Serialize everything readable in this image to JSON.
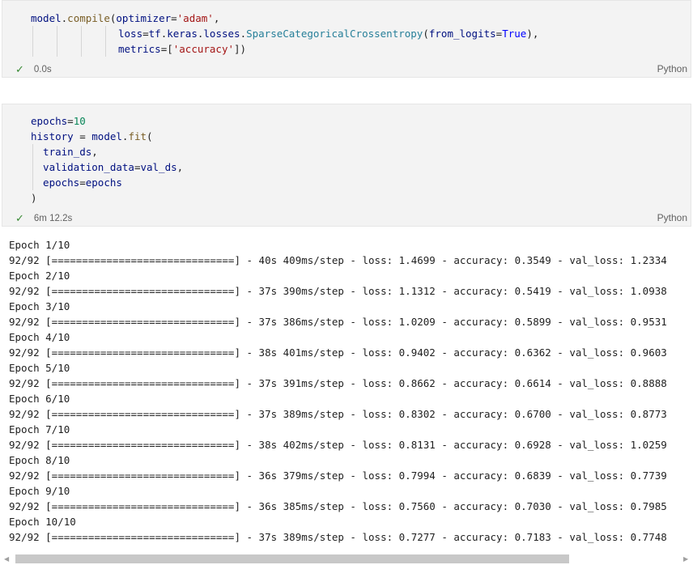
{
  "cells": [
    {
      "exec_time": "0.0s",
      "language": "Python",
      "code_lines": [
        [
          [
            "model",
            "k"
          ],
          [
            ".",
            "p"
          ],
          [
            "compile",
            "f"
          ],
          [
            "(",
            "p"
          ],
          [
            "optimizer",
            "k"
          ],
          [
            "=",
            "p"
          ],
          [
            "'adam'",
            "s"
          ],
          [
            ",",
            "p"
          ]
        ],
        [
          [
            "loss",
            "k"
          ],
          [
            "=",
            "p"
          ],
          [
            "tf",
            "k"
          ],
          [
            ".",
            "p"
          ],
          [
            "keras",
            "k"
          ],
          [
            ".",
            "p"
          ],
          [
            "losses",
            "k"
          ],
          [
            ".",
            "p"
          ],
          [
            "SparseCategoricalCrossentropy",
            "t"
          ],
          [
            "(",
            "p"
          ],
          [
            "from_logits",
            "k"
          ],
          [
            "=",
            "p"
          ],
          [
            "True",
            "c"
          ],
          [
            "),",
            "p"
          ]
        ],
        [
          [
            "metrics",
            "k"
          ],
          [
            "=",
            "p"
          ],
          [
            "[",
            "p"
          ],
          [
            "'accuracy'",
            "s"
          ],
          [
            "])",
            "p"
          ]
        ]
      ]
    },
    {
      "exec_time": "6m 12.2s",
      "language": "Python",
      "code_lines": [
        [
          [
            "epochs",
            "k"
          ],
          [
            "=",
            "p"
          ],
          [
            "10",
            "n"
          ]
        ],
        [
          [
            "history",
            "k"
          ],
          [
            " = ",
            "p"
          ],
          [
            "model",
            "k"
          ],
          [
            ".",
            "p"
          ],
          [
            "fit",
            "f"
          ],
          [
            "(",
            "p"
          ]
        ],
        [
          [
            "  train_ds",
            "k"
          ],
          [
            ",",
            "p"
          ]
        ],
        [
          [
            "  validation_data",
            "k"
          ],
          [
            "=",
            "p"
          ],
          [
            "val_ds",
            "k"
          ],
          [
            ",",
            "p"
          ]
        ],
        [
          [
            "  epochs",
            "k"
          ],
          [
            "=",
            "p"
          ],
          [
            "epochs",
            "k"
          ]
        ],
        [
          [
            ")",
            "p"
          ]
        ]
      ]
    }
  ],
  "output_lines": [
    "Epoch 1/10",
    "92/92 [==============================] - 40s 409ms/step - loss: 1.4699 - accuracy: 0.3549 - val_loss: 1.2334",
    "Epoch 2/10",
    "92/92 [==============================] - 37s 390ms/step - loss: 1.1312 - accuracy: 0.5419 - val_loss: 1.0938",
    "Epoch 3/10",
    "92/92 [==============================] - 37s 386ms/step - loss: 1.0209 - accuracy: 0.5899 - val_loss: 0.9531",
    "Epoch 4/10",
    "92/92 [==============================] - 38s 401ms/step - loss: 0.9402 - accuracy: 0.6362 - val_loss: 0.9603",
    "Epoch 5/10",
    "92/92 [==============================] - 37s 391ms/step - loss: 0.8662 - accuracy: 0.6614 - val_loss: 0.8888",
    "Epoch 6/10",
    "92/92 [==============================] - 37s 389ms/step - loss: 0.8302 - accuracy: 0.6700 - val_loss: 0.8773",
    "Epoch 7/10",
    "92/92 [==============================] - 38s 402ms/step - loss: 0.8131 - accuracy: 0.6928 - val_loss: 1.0259",
    "Epoch 8/10",
    "92/92 [==============================] - 36s 379ms/step - loss: 0.7994 - accuracy: 0.6839 - val_loss: 0.7739",
    "Epoch 9/10",
    "92/92 [==============================] - 36s 385ms/step - loss: 0.7560 - accuracy: 0.7030 - val_loss: 0.7985",
    "Epoch 10/10",
    "92/92 [==============================] - 37s 389ms/step - loss: 0.7277 - accuracy: 0.7183 - val_loss: 0.7748"
  ],
  "icons": {
    "success": "check-icon",
    "scroll_left": "arrow-left-icon",
    "scroll_right": "arrow-right-icon"
  },
  "colors": {
    "success": "#388a34",
    "cell_background": "#f3f3f3"
  }
}
